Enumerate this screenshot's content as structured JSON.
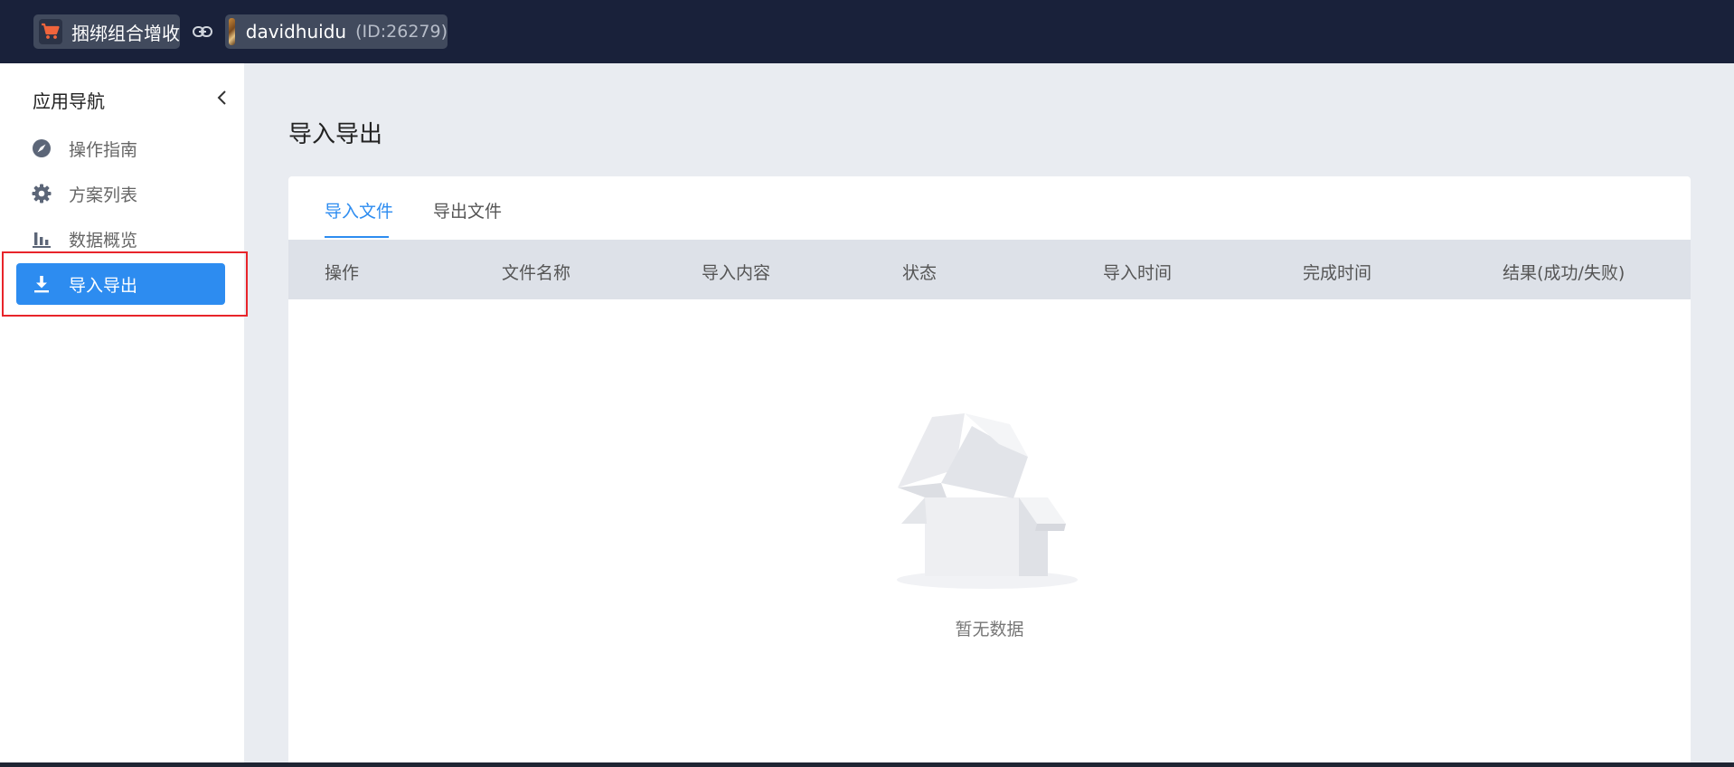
{
  "header": {
    "app_name": "捆绑组合增收",
    "username": "davidhuidu",
    "user_id": "(ID:26279)"
  },
  "sidebar": {
    "title": "应用导航",
    "items": [
      {
        "label": "操作指南",
        "icon": "compass-icon"
      },
      {
        "label": "方案列表",
        "icon": "gear-icon"
      },
      {
        "label": "数据概览",
        "icon": "bar-chart-icon"
      },
      {
        "label": "导入导出",
        "icon": "download-icon",
        "active": true
      }
    ]
  },
  "main": {
    "title": "导入导出",
    "tabs": [
      {
        "label": "导入文件",
        "active": true
      },
      {
        "label": "导出文件"
      }
    ],
    "columns": [
      "操作",
      "文件名称",
      "导入内容",
      "状态",
      "导入时间",
      "完成时间",
      "结果(成功/失败)"
    ],
    "empty_text": "暂无数据"
  },
  "colors": {
    "topbar": "#19213a",
    "accent": "#2d8cf0",
    "highlight": "#e8242a"
  }
}
